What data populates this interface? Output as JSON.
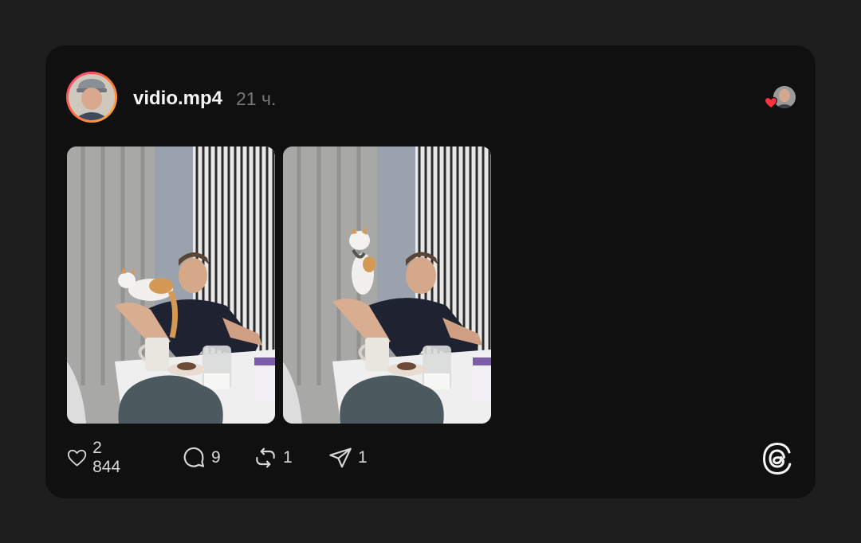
{
  "post": {
    "username": "vidio.mp4",
    "time": "21 ч.",
    "media_count": 2
  },
  "actions": {
    "likes": "2 844",
    "replies": "9",
    "reposts": "1",
    "shares": "1"
  },
  "icons": {
    "like": "heart-icon",
    "reply": "speech-bubble-icon",
    "repost": "repost-arrows-icon",
    "share": "paper-plane-icon",
    "brand": "threads-logo-icon",
    "liked_by": "red-heart-icon"
  },
  "colors": {
    "page_bg": "#1e1e1e",
    "card_bg": "#101010",
    "text_primary": "#f3f5f7",
    "text_secondary": "#777777",
    "heart_red": "#ff3040",
    "avatar_ring_start": "#ff3d7f",
    "avatar_ring_end": "#ffb13d"
  }
}
